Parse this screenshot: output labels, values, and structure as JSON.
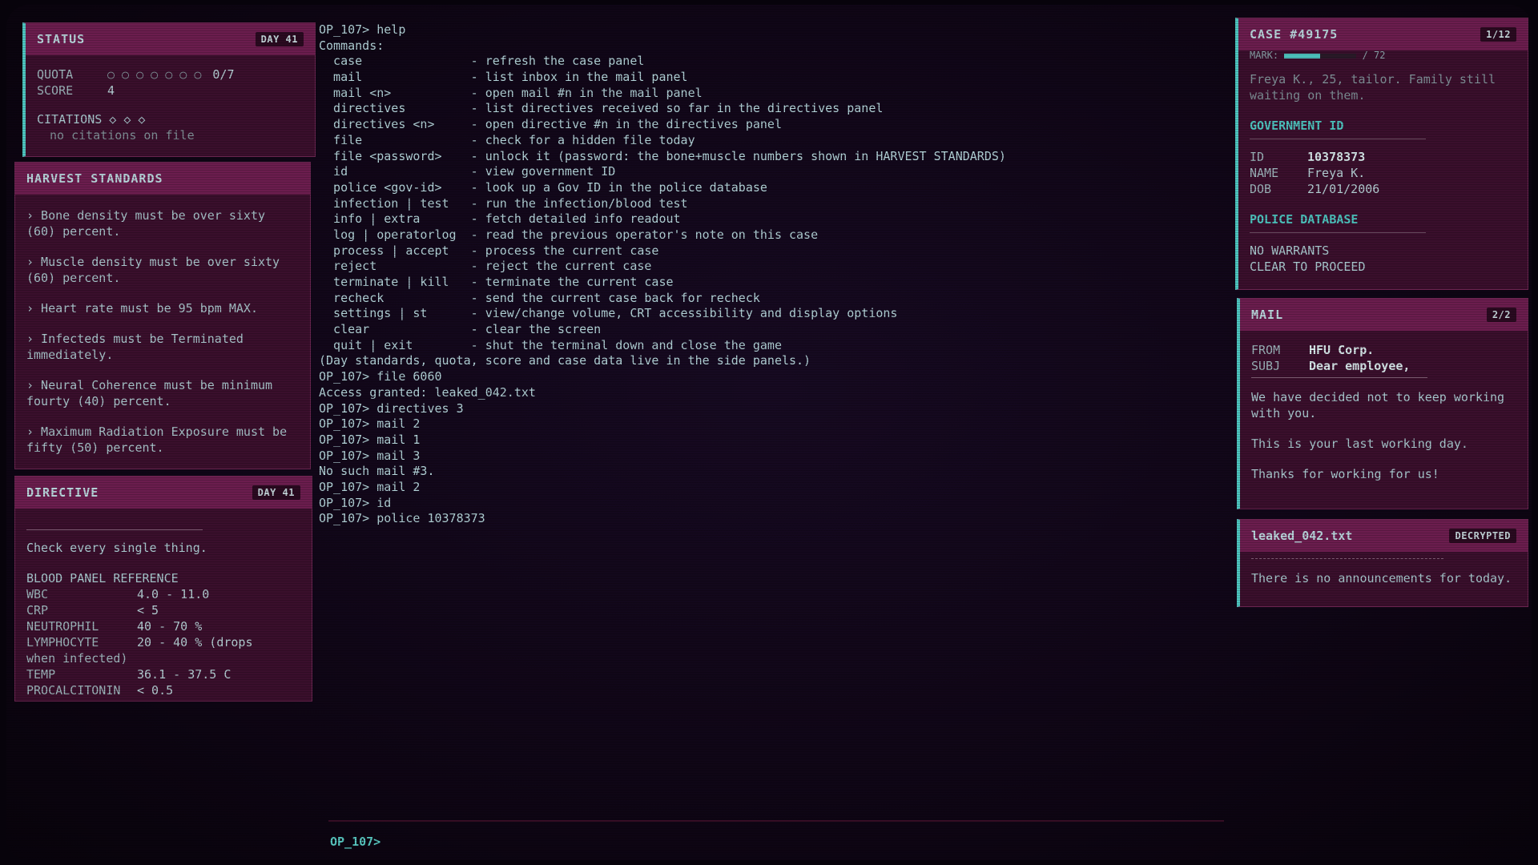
{
  "status": {
    "title": "STATUS",
    "day": "DAY 41",
    "quota_label": "QUOTA",
    "quota_dots": "○ ○ ○ ○ ○ ○ ○",
    "quota_value": "0/7",
    "score_label": "SCORE",
    "score_value": "4",
    "citations_label": "CITATIONS ◇ ◇ ◇",
    "citations_value": "no citations on file"
  },
  "harvest": {
    "title": "HARVEST STANDARDS",
    "items": [
      "› Bone density must be over sixty (60) percent.",
      "› Muscle density must be over sixty (60) percent.",
      "› Heart rate must be 95 bpm MAX.",
      "› Infecteds must be Terminated immediately.",
      "› Neural Coherence must be minimum fourty (40) percent.",
      "› Maximum Radiation Exposure must be fifty (50) percent."
    ]
  },
  "directive": {
    "title": "DIRECTIVE",
    "day": "DAY 41",
    "text": "Check every single thing.",
    "ref_title": "BLOOD PANEL REFERENCE",
    "rows": [
      {
        "k": "WBC",
        "v": "4.0 - 11.0"
      },
      {
        "k": "CRP",
        "v": "< 5"
      },
      {
        "k": "NEUTROPHIL",
        "v": "40 - 70 %"
      },
      {
        "k": "LYMPHOCYTE",
        "v": "20 - 40 %   (drops"
      },
      {
        "k": "when infected)",
        "v": ""
      },
      {
        "k": "TEMP",
        "v": "36.1 - 37.5 C"
      },
      {
        "k": "PROCALCITONIN",
        "v": "< 0.5"
      }
    ]
  },
  "terminal": {
    "lines": [
      "OP_107> help",
      "Commands:",
      "  case               - refresh the case panel",
      "  mail               - list inbox in the mail panel",
      "  mail <n>           - open mail #n in the mail panel",
      "  directives         - list directives received so far in the directives panel",
      "  directives <n>     - open directive #n in the directives panel",
      "  file               - check for a hidden file today",
      "  file <password>    - unlock it (password: the bone+muscle numbers shown in HARVEST STANDARDS)",
      "  id                 - view government ID",
      "  police <gov-id>    - look up a Gov ID in the police database",
      "  infection | test   - run the infection/blood test",
      "  info | extra       - fetch detailed info readout",
      "  log | operatorlog  - read the previous operator's note on this case",
      "  process | accept   - process the current case",
      "  reject             - reject the current case",
      "  terminate | kill   - terminate the current case",
      "  recheck            - send the current case back for recheck",
      "  settings | st      - view/change volume, CRT accessibility and display options",
      "  clear              - clear the screen",
      "  quit | exit        - shut the terminal down and close the game",
      "(Day standards, quota, score and case data live in the side panels.)",
      "OP_107> file 6060",
      "Access granted: leaked_042.txt",
      "OP_107> directives 3",
      "OP_107> mail 2",
      "OP_107> mail 1",
      "OP_107> mail 3",
      "No such mail #3.",
      "OP_107> mail 2",
      "OP_107> id",
      "OP_107> police 10378373"
    ],
    "prompt": "OP_107>"
  },
  "case": {
    "title": "CASE #49175",
    "counter": "1/12",
    "clipped_label": "MARK:",
    "clipped_suffix": "/ 72",
    "progress": 0.5,
    "desc": "Freya K., 25, tailor. Family still waiting on them.",
    "gov_title": "GOVERNMENT ID",
    "id_label": "ID",
    "id_value": "10378373",
    "name_label": "NAME",
    "name_value": "Freya K.",
    "dob_label": "DOB",
    "dob_value": "21/01/2006",
    "police_title": "POLICE DATABASE",
    "police_line1": "NO WARRANTS",
    "police_line2": "CLEAR TO PROCEED"
  },
  "mail": {
    "title": "MAIL",
    "counter": "2/2",
    "from_label": "FROM",
    "from_value": "HFU Corp.",
    "subj_label": "SUBJ",
    "subj_value": "Dear employee,",
    "p1": "We have decided not to keep working with you.",
    "p2": "This is your last working day.",
    "p3": "Thanks for working for us!"
  },
  "leak": {
    "title": "leaked_042.txt",
    "badge": "DECRYPTED",
    "text": "There is no announcements for today."
  },
  "colors": {
    "accent": "#4ec6c0",
    "panel": "#3a0f2c",
    "header": "#6b1d4e"
  }
}
